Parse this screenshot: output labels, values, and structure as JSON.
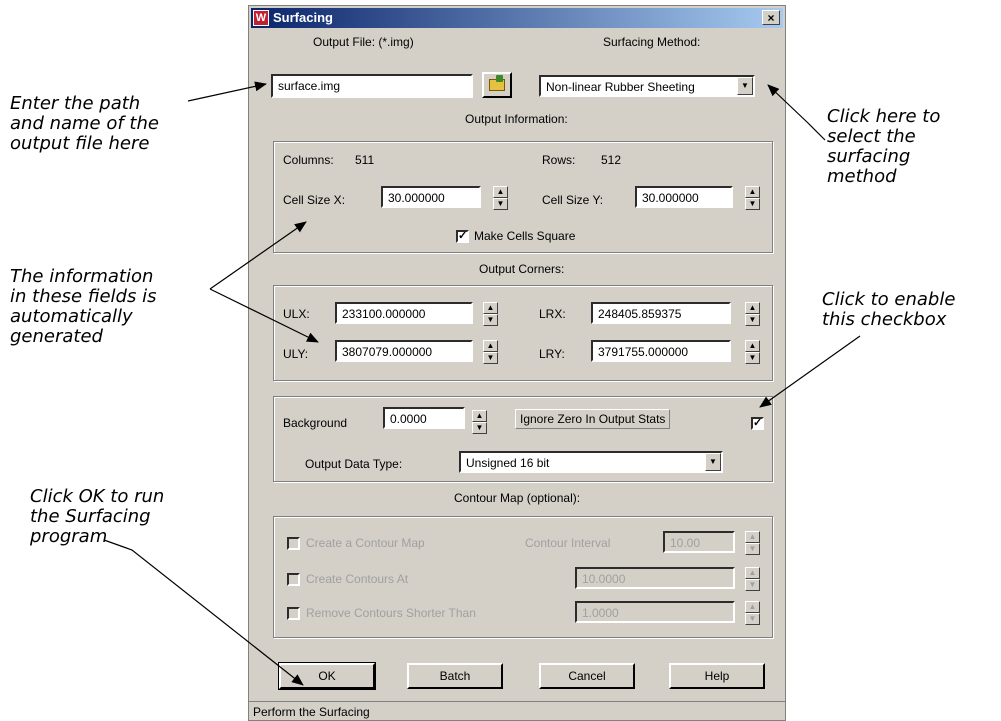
{
  "dialog": {
    "title": "Surfacing",
    "close_glyph": "×",
    "output_file_label": "Output File: (*.img)",
    "output_file_value": "surface.img",
    "method_label": "Surfacing Method:",
    "method_value": "Non-linear Rubber Sheeting",
    "output_info_header": "Output Information:",
    "columns_label": "Columns:",
    "columns_value": "511",
    "rows_label": "Rows:",
    "rows_value": "512",
    "cellx_label": "Cell Size X:",
    "cellx_value": "30.000000",
    "celly_label": "Cell Size Y:",
    "celly_value": "30.000000",
    "make_square_label": "Make Cells Square",
    "output_corners_header": "Output Corners:",
    "ulx_label": "ULX:",
    "ulx_value": "233100.000000",
    "lrx_label": "LRX:",
    "lrx_value": "248405.859375",
    "uly_label": "ULY:",
    "uly_value": "3807079.000000",
    "lry_label": "LRY:",
    "lry_value": "3791755.000000",
    "background_label": "Background",
    "background_value": "0.0000",
    "ignore_zero_label": "Ignore Zero In Output Stats",
    "data_type_label": "Output Data Type:",
    "data_type_value": "Unsigned 16 bit",
    "contour_header": "Contour Map (optional):",
    "create_contour_label": "Create a Contour Map",
    "contour_interval_label": "Contour Interval",
    "contour_interval_value": "10.00",
    "create_contours_at_label": "Create Contours At",
    "create_contours_at_value": "10.0000",
    "remove_contours_label": "Remove Contours Shorter Than",
    "remove_contours_value": "1.0000",
    "ok_label": "OK",
    "batch_label": "Batch",
    "cancel_label": "Cancel",
    "help_label": "Help",
    "status_text": "Perform the Surfacing"
  },
  "annotations": {
    "enter_path": "Enter the path\nand name of the\noutput file here",
    "click_method": "Click here to\nselect the\nsurfacing\nmethod",
    "info_generated": "The information\nin these fields is\nautomatically\ngenerated",
    "enable_checkbox": "Click to enable\nthis checkbox",
    "click_ok": "Click OK to run\nthe Surfacing\nprogram"
  },
  "colors": {
    "dialog_face": "#d4d0c8",
    "titlebar": "#0a246a"
  }
}
